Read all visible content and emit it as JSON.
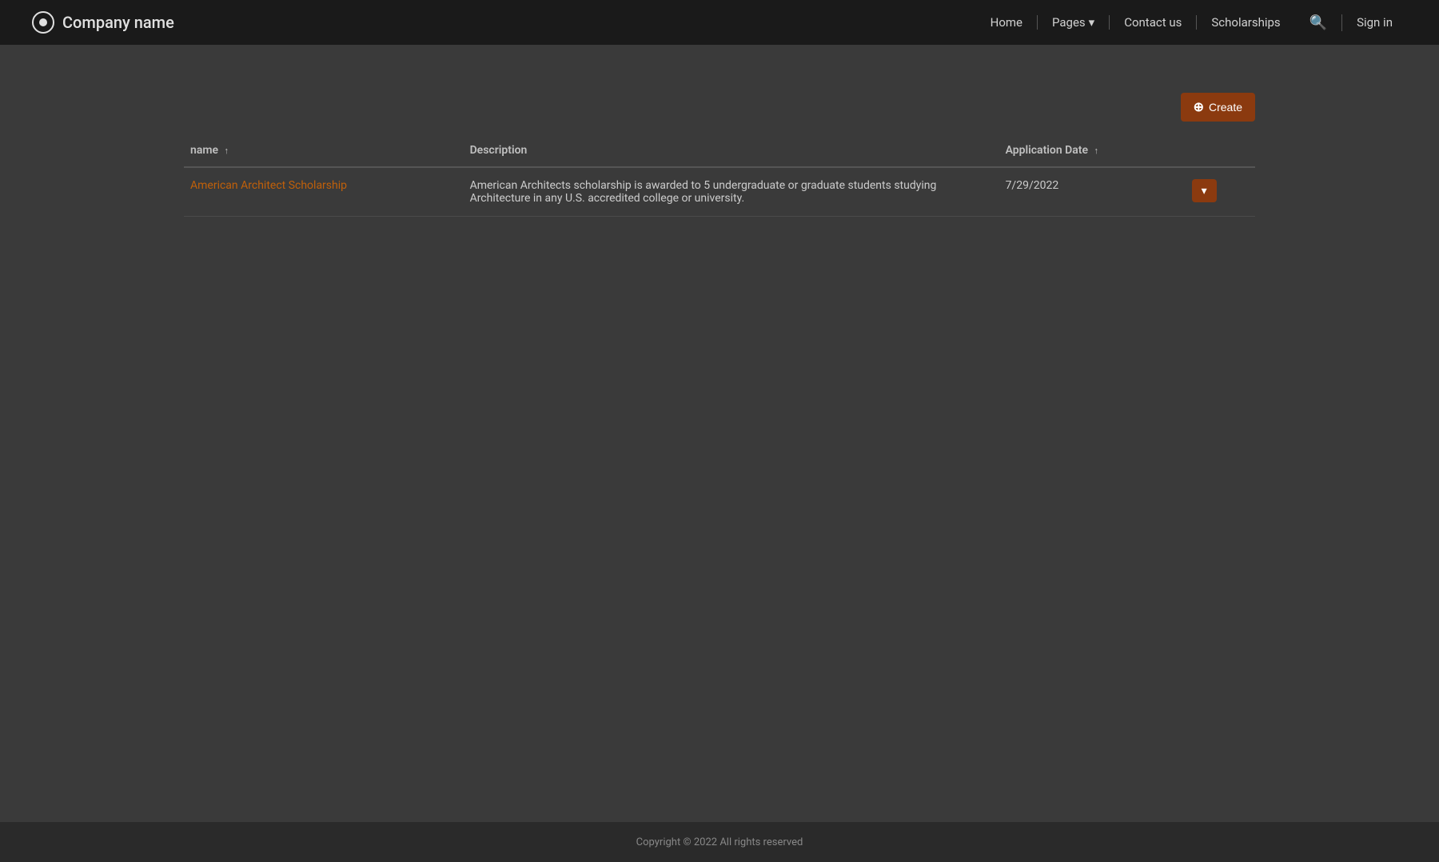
{
  "nav": {
    "brand": {
      "name": "Company name"
    },
    "links": [
      {
        "id": "home",
        "label": "Home",
        "hasDropdown": false
      },
      {
        "id": "pages",
        "label": "Pages",
        "hasDropdown": true
      },
      {
        "id": "contact",
        "label": "Contact us",
        "hasDropdown": false
      },
      {
        "id": "scholarships",
        "label": "Scholarships",
        "hasDropdown": false
      }
    ],
    "signin_label": "Sign in"
  },
  "toolbar": {
    "create_label": "Create"
  },
  "table": {
    "columns": [
      {
        "id": "name",
        "label": "name",
        "sortable": true
      },
      {
        "id": "description",
        "label": "Description",
        "sortable": false
      },
      {
        "id": "application_date",
        "label": "Application Date",
        "sortable": true
      },
      {
        "id": "action",
        "label": "",
        "sortable": false
      }
    ],
    "rows": [
      {
        "name": "American Architect Scholarship",
        "description": "American Architects scholarship is awarded to 5 undergraduate or graduate students studying Architecture in any U.S. accredited college or university.",
        "application_date": "7/29/2022"
      }
    ]
  },
  "footer": {
    "copyright": "Copyright © 2022  All rights reserved"
  }
}
